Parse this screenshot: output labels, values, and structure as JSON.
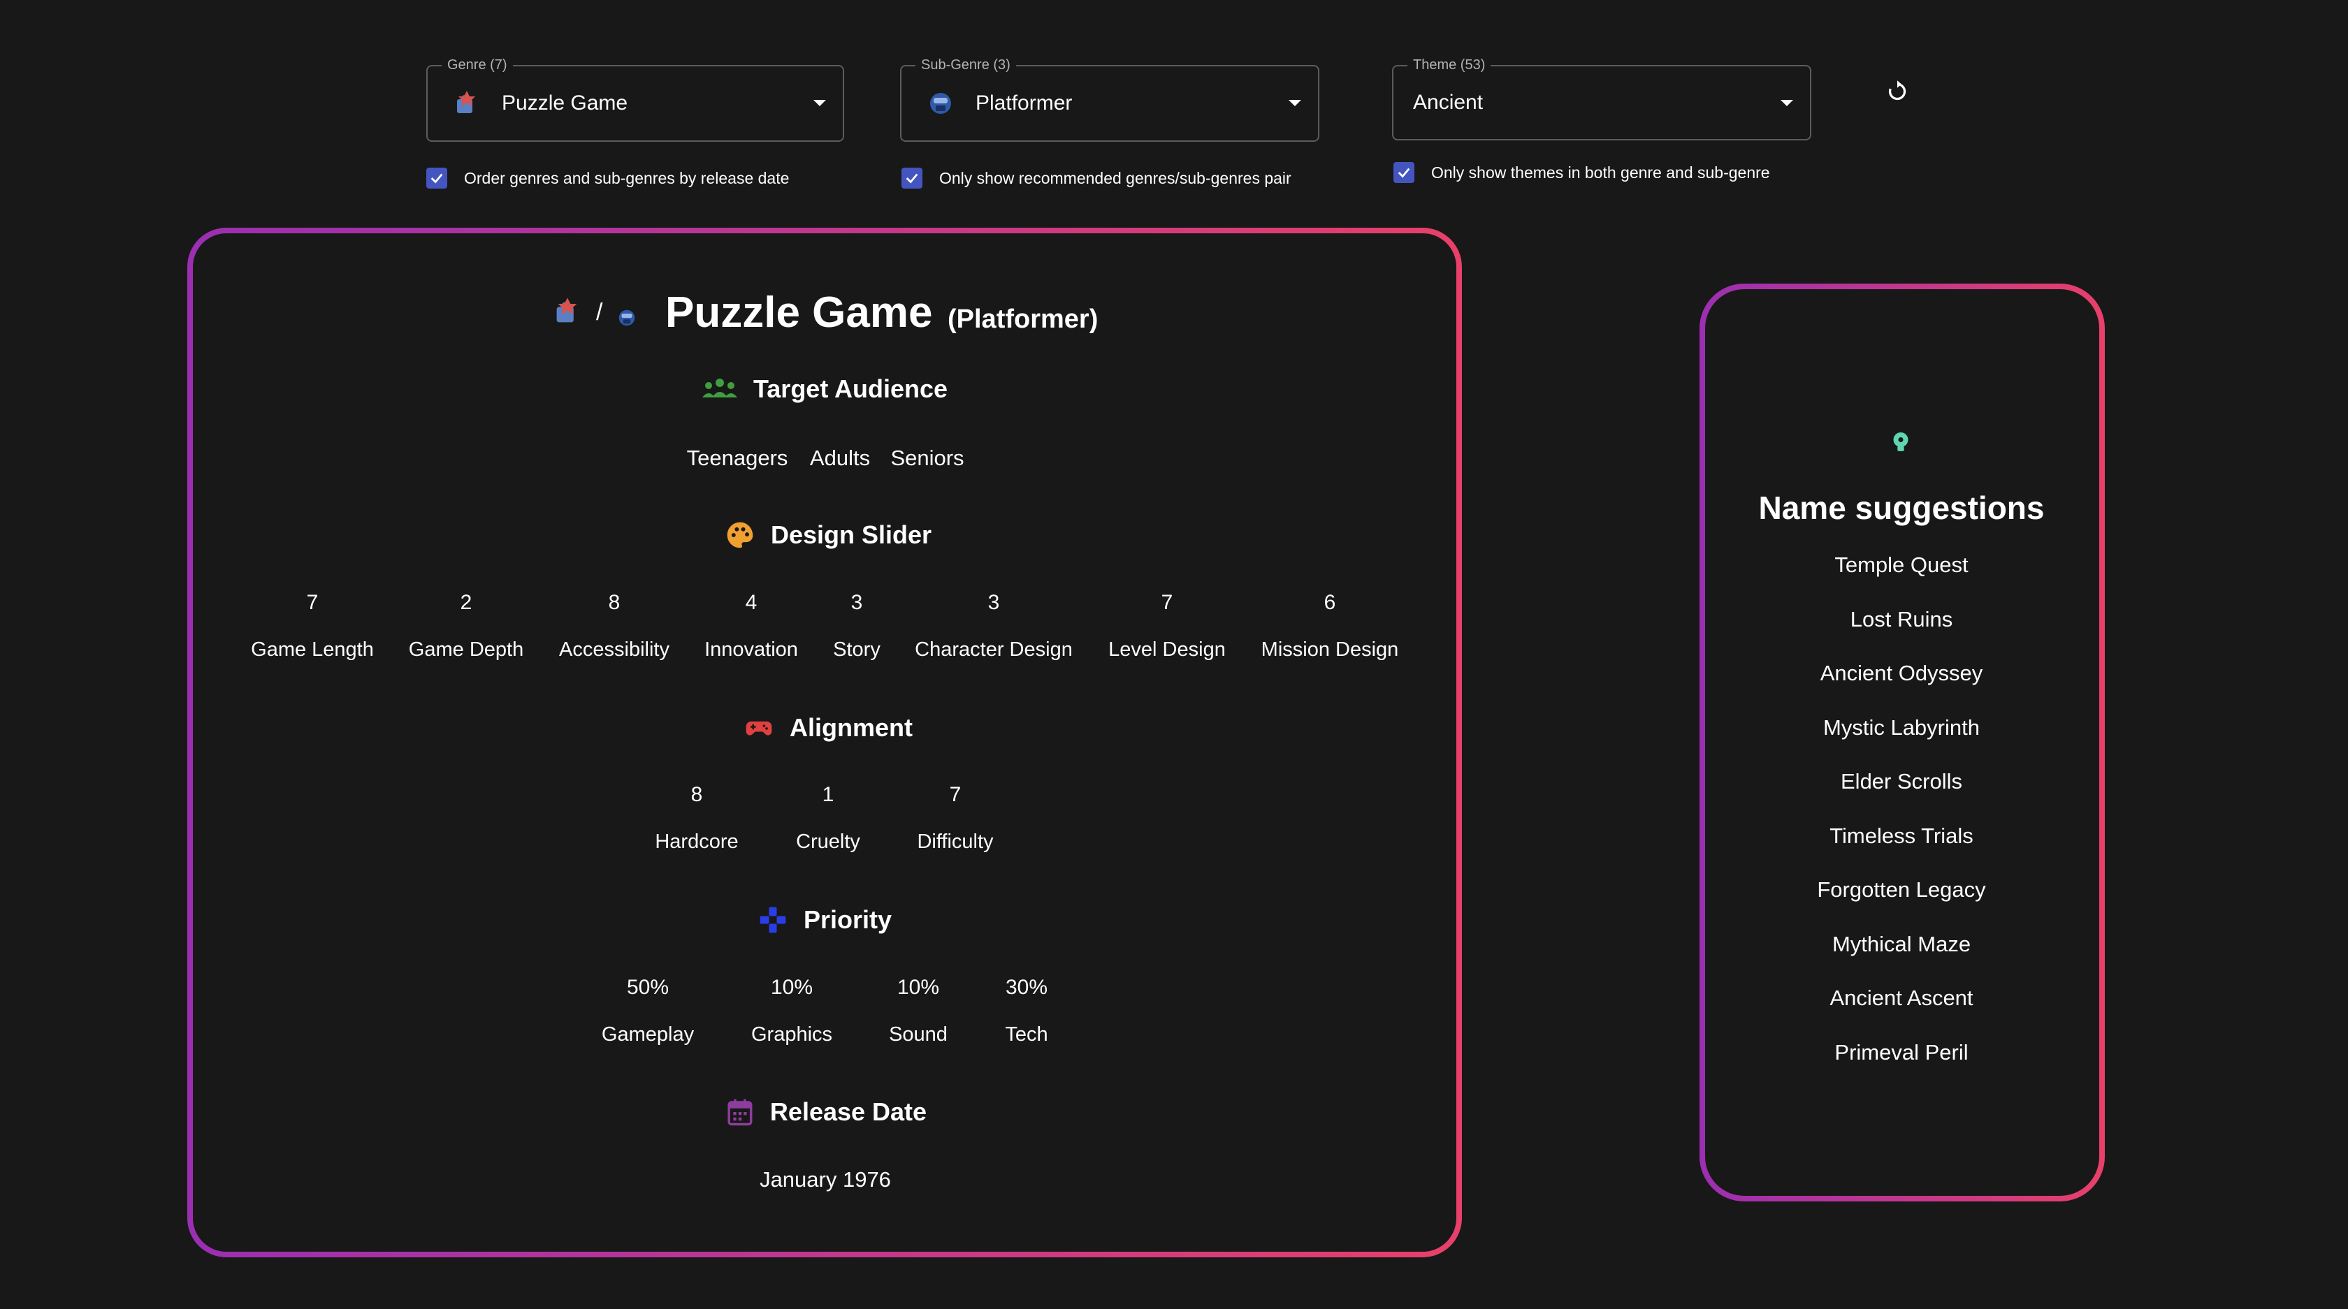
{
  "filters": {
    "genre": {
      "legend": "Genre (7)",
      "value": "Puzzle Game",
      "icon": "puzzle-genre-icon"
    },
    "subgenre": {
      "legend": "Sub-Genre (3)",
      "value": "Platformer",
      "icon": "platformer-subgenre-icon"
    },
    "theme": {
      "legend": "Theme (53)",
      "value": "Ancient"
    },
    "checkboxes": {
      "order": "Order genres and sub-genres by release date",
      "recommended": "Only show recommended genres/sub-genres pair",
      "themes_both": "Only show themes in both genre and sub-genre"
    },
    "reset_icon": "refresh-icon"
  },
  "main": {
    "separator": "/",
    "title": "Puzzle Game",
    "subtitle": "(Platformer)",
    "target_audience": {
      "heading": "Target Audience",
      "items": [
        "Teenagers",
        "Adults",
        "Seniors"
      ]
    },
    "design_slider": {
      "heading": "Design Slider",
      "items": [
        {
          "value": "7",
          "label": "Game Length"
        },
        {
          "value": "2",
          "label": "Game Depth"
        },
        {
          "value": "8",
          "label": "Accessibility"
        },
        {
          "value": "4",
          "label": "Innovation"
        },
        {
          "value": "3",
          "label": "Story"
        },
        {
          "value": "3",
          "label": "Character Design"
        },
        {
          "value": "7",
          "label": "Level Design"
        },
        {
          "value": "6",
          "label": "Mission Design"
        }
      ]
    },
    "alignment": {
      "heading": "Alignment",
      "items": [
        {
          "value": "8",
          "label": "Hardcore"
        },
        {
          "value": "1",
          "label": "Cruelty"
        },
        {
          "value": "7",
          "label": "Difficulty"
        }
      ]
    },
    "priority": {
      "heading": "Priority",
      "items": [
        {
          "value": "50%",
          "label": "Gameplay"
        },
        {
          "value": "10%",
          "label": "Graphics"
        },
        {
          "value": "10%",
          "label": "Sound"
        },
        {
          "value": "30%",
          "label": "Tech"
        }
      ]
    },
    "release": {
      "heading": "Release Date",
      "value": "January 1976"
    }
  },
  "names": {
    "heading": "Name suggestions",
    "items": [
      "Temple Quest",
      "Lost Ruins",
      "Ancient Odyssey",
      "Mystic Labyrinth",
      "Elder Scrolls",
      "Timeless Trials",
      "Forgotten Legacy",
      "Mythical Maze",
      "Ancient Ascent",
      "Primeval Peril"
    ]
  },
  "colors": {
    "background": "#181818",
    "card_gradient_start": "#9b2fb2",
    "card_gradient_end": "#e8406a",
    "checkbox": "#4555c0",
    "audience_icon": "#3f9f3f",
    "palette_icon": "#f0a030",
    "gamepad_icon": "#e04040",
    "priority_icon": "#2a3ee8",
    "calendar_icon": "#8e3c9e",
    "bulb_icon": "#5fd6b0"
  }
}
